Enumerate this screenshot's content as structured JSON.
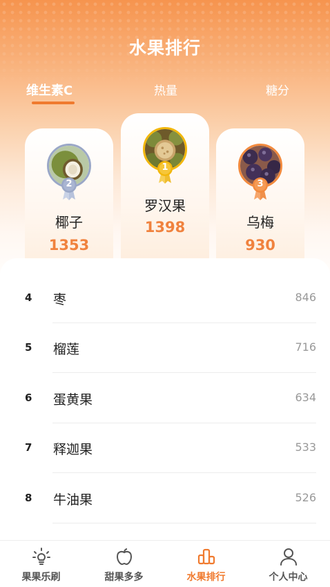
{
  "header": {
    "title": "水果排行"
  },
  "tabs": [
    {
      "label": "维生素C",
      "active": true
    },
    {
      "label": "热量",
      "active": false
    },
    {
      "label": "糖分",
      "active": false
    }
  ],
  "podium": [
    {
      "rank": "2",
      "name": "椰子",
      "value": "1353",
      "image": "coconut-image"
    },
    {
      "rank": "1",
      "name": "罗汉果",
      "value": "1398",
      "image": "monk-fruit-image"
    },
    {
      "rank": "3",
      "name": "乌梅",
      "value": "930",
      "image": "black-plum-image"
    }
  ],
  "list": [
    {
      "rank": "4",
      "name": "枣",
      "value": "846"
    },
    {
      "rank": "5",
      "name": "榴莲",
      "value": "716"
    },
    {
      "rank": "6",
      "name": "蛋黄果",
      "value": "634"
    },
    {
      "rank": "7",
      "name": "释迦果",
      "value": "533"
    },
    {
      "rank": "8",
      "name": "牛油果",
      "value": "526"
    }
  ],
  "tabbar": [
    {
      "label": "果果乐刷",
      "icon": "lightbulb-icon",
      "active": false
    },
    {
      "label": "甜果多多",
      "icon": "apple-icon",
      "active": false
    },
    {
      "label": "水果排行",
      "icon": "bar-chart-icon",
      "active": true
    },
    {
      "label": "个人中心",
      "icon": "person-icon",
      "active": false
    }
  ],
  "colors": {
    "accent": "#f07a2e",
    "gold": "#f2b70c",
    "silver": "#9aa7c7",
    "bronze": "#f28a3e"
  }
}
